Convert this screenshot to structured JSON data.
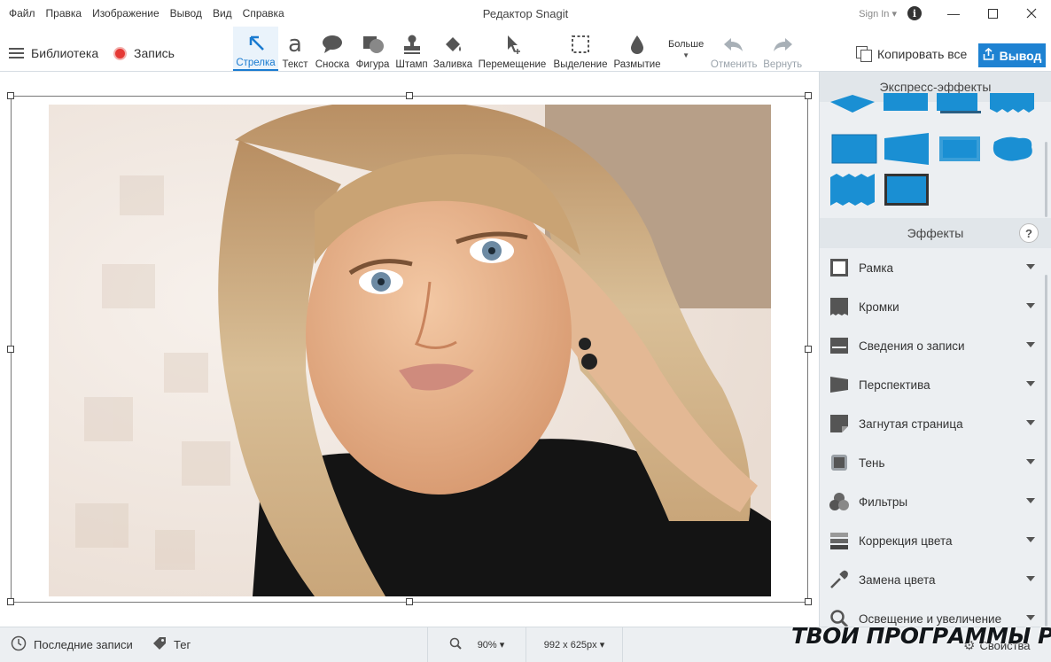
{
  "window": {
    "title": "Редактор Snagit",
    "menu": [
      "Файл",
      "Правка",
      "Изображение",
      "Вывод",
      "Вид",
      "Справка"
    ],
    "sign_in": "Sign In"
  },
  "toolbar": {
    "library": "Библиотека",
    "record": "Запись",
    "tools": [
      {
        "label": "Стрелка",
        "icon": "arrow-icon"
      },
      {
        "label": "Текст",
        "icon": "text-icon"
      },
      {
        "label": "Сноска",
        "icon": "callout-icon"
      },
      {
        "label": "Фигура",
        "icon": "shape-icon"
      },
      {
        "label": "Штамп",
        "icon": "stamp-icon"
      },
      {
        "label": "Заливка",
        "icon": "fill-icon"
      },
      {
        "label": "Перемещение",
        "icon": "move-icon"
      },
      {
        "label": "Выделение",
        "icon": "selection-icon"
      },
      {
        "label": "Размытие",
        "icon": "blur-icon"
      }
    ],
    "more": "Больше",
    "undo": "Отменить",
    "redo": "Вернуть",
    "copy_all": "Копировать все",
    "output": "Вывод",
    "accent": "#1e82d2"
  },
  "panel": {
    "quick_effects_title": "Экспресс-эффекты",
    "effects_title": "Эффекты",
    "help": "?",
    "effects": [
      {
        "label": "Рамка",
        "icon": "border-icon"
      },
      {
        "label": "Кромки",
        "icon": "edges-icon"
      },
      {
        "label": "Сведения о записи",
        "icon": "capture-info-icon"
      },
      {
        "label": "Перспектива",
        "icon": "perspective-icon"
      },
      {
        "label": "Загнутая страница",
        "icon": "page-curl-icon"
      },
      {
        "label": "Тень",
        "icon": "shadow-icon"
      },
      {
        "label": "Фильтры",
        "icon": "filters-icon"
      },
      {
        "label": "Коррекция цвета",
        "icon": "color-adjust-icon"
      },
      {
        "label": "Замена цвета",
        "icon": "color-replace-icon"
      },
      {
        "label": "Освещение и увеличение",
        "icon": "spotlight-icon"
      }
    ]
  },
  "status": {
    "recent": "Последние записи",
    "tag": "Тег",
    "zoom": "90%",
    "size": "992 x 625px",
    "properties": "Свойства",
    "watermark": "ТВОИ ПРОГРАММЫ РУ"
  }
}
